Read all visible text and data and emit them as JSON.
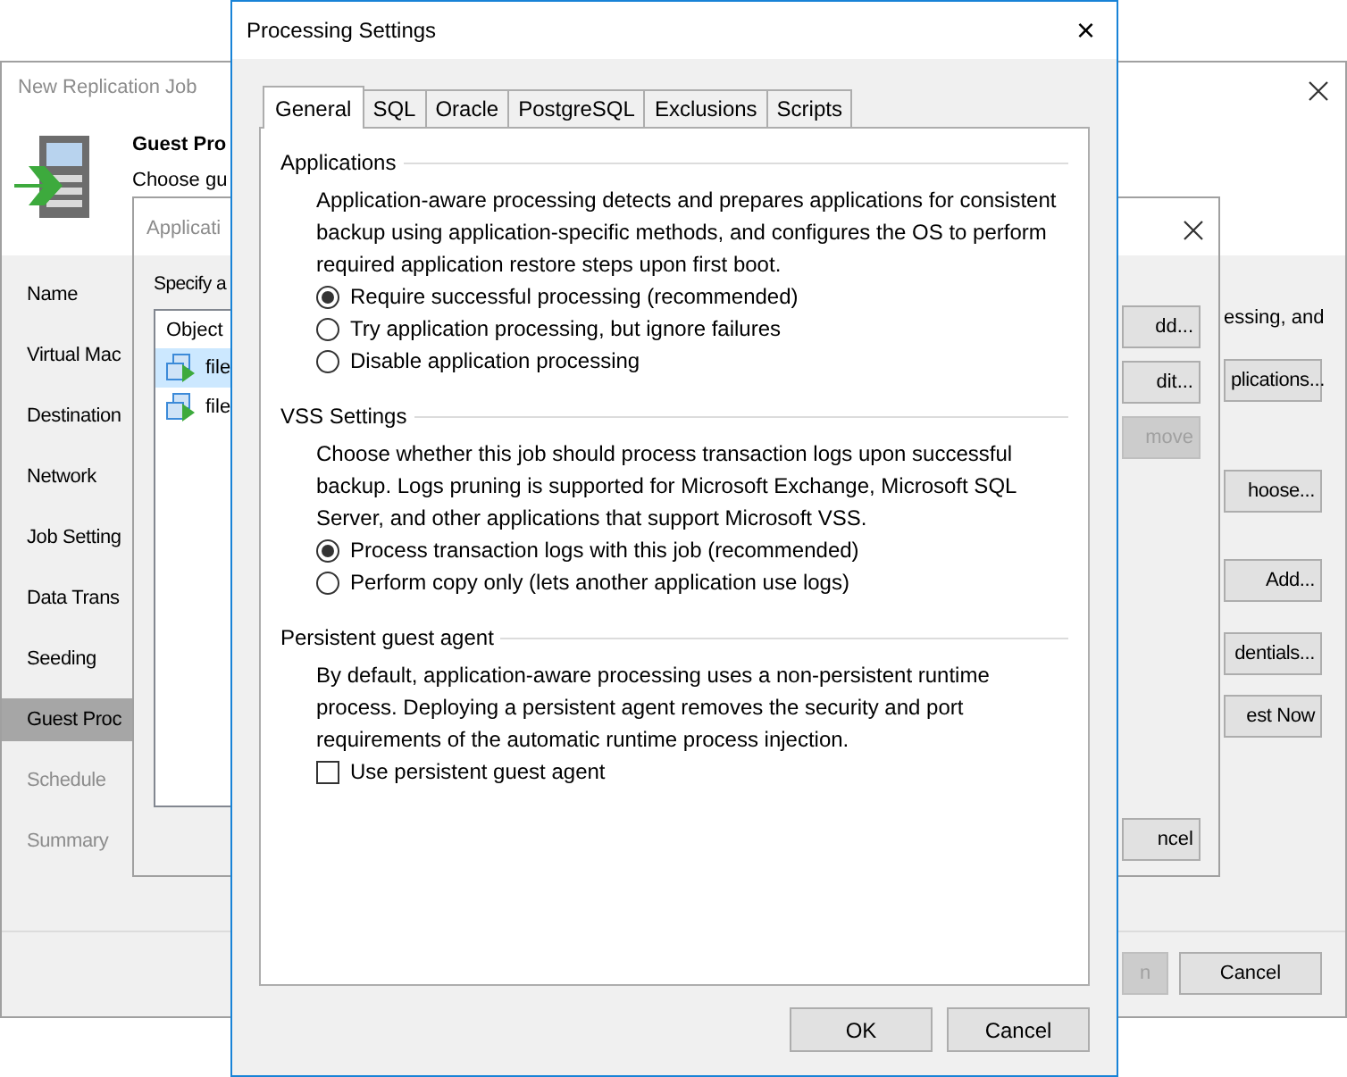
{
  "wizard": {
    "title": "New Replication Job",
    "header_title": "Guest Pro",
    "header_subtitle": "Choose gu",
    "description_fragment": "essing, and",
    "steps": [
      {
        "label": "Name",
        "selected": false,
        "disabled": false
      },
      {
        "label": "Virtual Mac",
        "selected": false,
        "disabled": false
      },
      {
        "label": "Destination",
        "selected": false,
        "disabled": false
      },
      {
        "label": "Network",
        "selected": false,
        "disabled": false
      },
      {
        "label": "Job Setting",
        "selected": false,
        "disabled": false
      },
      {
        "label": "Data Trans",
        "selected": false,
        "disabled": false
      },
      {
        "label": "Seeding",
        "selected": false,
        "disabled": false
      },
      {
        "label": "Guest Proc",
        "selected": true,
        "disabled": false
      },
      {
        "label": "Schedule",
        "selected": false,
        "disabled": true
      },
      {
        "label": "Summary",
        "selected": false,
        "disabled": true
      }
    ],
    "side_buttons": [
      "plications...",
      "hoose...",
      "Add...",
      "dentials...",
      "est Now"
    ],
    "footer_buttons": [
      {
        "label": "n",
        "disabled": true
      },
      {
        "label": "Cancel",
        "disabled": false
      }
    ]
  },
  "applications_dialog": {
    "title": "Applicati",
    "prompt": "Specify a",
    "column": "Object",
    "rows": [
      {
        "label": "file",
        "selected": true
      },
      {
        "label": "file",
        "selected": false
      }
    ],
    "buttons": [
      {
        "label": "dd...",
        "disabled": false
      },
      {
        "label": "dit...",
        "disabled": false
      },
      {
        "label": "move",
        "disabled": true
      }
    ],
    "footer_button": "ncel"
  },
  "processing_settings": {
    "title": "Processing Settings",
    "close": "×",
    "tabs": [
      {
        "label": "General",
        "selected": true
      },
      {
        "label": "SQL",
        "selected": false
      },
      {
        "label": "Oracle",
        "selected": false
      },
      {
        "label": "PostgreSQL",
        "selected": false
      },
      {
        "label": "Exclusions",
        "selected": false
      },
      {
        "label": "Scripts",
        "selected": false
      }
    ],
    "groups": [
      {
        "title": "Applications",
        "description": "Application-aware processing detects and prepares applications for consistent backup using application-specific methods, and configures the OS to perform required application restore steps upon first boot.",
        "options": [
          {
            "kind": "radio",
            "label": "Require successful processing (recommended)",
            "checked": true
          },
          {
            "kind": "radio",
            "label": "Try application processing, but ignore failures",
            "checked": false
          },
          {
            "kind": "radio",
            "label": "Disable application processing",
            "checked": false
          }
        ]
      },
      {
        "title": "VSS Settings",
        "description": "Choose whether this job should process transaction logs upon successful backup. Logs pruning is supported for Microsoft Exchange, Microsoft SQL Server, and other applications that support Microsoft VSS.",
        "options": [
          {
            "kind": "radio",
            "label": "Process transaction logs with this job (recommended)",
            "checked": true
          },
          {
            "kind": "radio",
            "label": "Perform copy only (lets another application use logs)",
            "checked": false
          }
        ]
      },
      {
        "title": "Persistent guest agent",
        "description": "By default, application-aware processing uses a non-persistent runtime process. Deploying a persistent agent removes the security and port requirements of the automatic runtime process injection.",
        "options": [
          {
            "kind": "checkbox",
            "label": "Use persistent guest agent",
            "checked": false
          }
        ]
      }
    ],
    "buttons": [
      "OK",
      "Cancel"
    ]
  }
}
